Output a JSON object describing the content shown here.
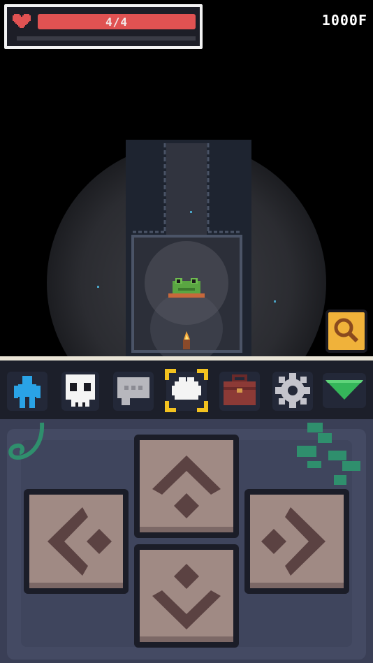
{
  "hud": {
    "hp_text": "4/4",
    "hp_fraction": 1.0,
    "floor_text": "1000F"
  },
  "toolbar": {
    "items": [
      {
        "icon": "character-icon"
      },
      {
        "icon": "skull-icon"
      },
      {
        "icon": "speech-bubble-icon"
      },
      {
        "icon": "wait-icon",
        "selected": true
      },
      {
        "icon": "backpack-icon"
      },
      {
        "icon": "gear-icon"
      },
      {
        "icon": "collapse-arrow-icon"
      }
    ]
  },
  "dpad": {
    "buttons": [
      "up",
      "left",
      "right",
      "down"
    ]
  },
  "colors": {
    "hp": "#e05252",
    "selection": "#f3c21f",
    "character": "#2aa3e6",
    "collapse": "#35b65a",
    "inspect": "#f0b23a",
    "panel": "#3a3f56",
    "button_face": "#a08a84"
  }
}
